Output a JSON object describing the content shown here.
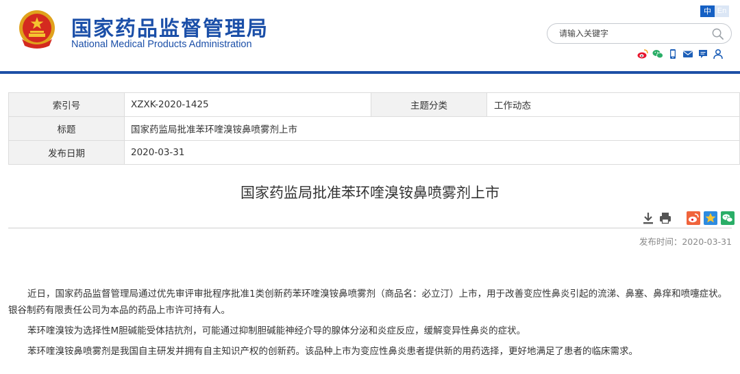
{
  "header": {
    "site_name_cn": "国家药品监督管理局",
    "site_name_en": "National Medical Products Administration",
    "lang_zh": "中",
    "lang_en": "En",
    "search_placeholder": "请输入关键字",
    "icons": [
      "weibo-icon",
      "wechat-icon",
      "mobile-icon",
      "mail-icon",
      "message-icon",
      "user-icon"
    ]
  },
  "info_table": {
    "index_label": "索引号",
    "index_value": "XZXK-2020-1425",
    "topic_label": "主题分类",
    "topic_value": "工作动态",
    "title_label": "标题",
    "title_value": "国家药监局批准苯环喹溴铵鼻喷雾剂上市",
    "date_label": "发布日期",
    "date_value": "2020-03-31"
  },
  "article": {
    "title": "国家药监局批准苯环喹溴铵鼻喷雾剂上市",
    "pub_time": "发布时间：2020-03-31",
    "paragraphs": [
      "近日，国家药品监督管理局通过优先审评审批程序批准1类创新药苯环喹溴铵鼻喷雾剂（商品名：必立汀）上市，用于改善变应性鼻炎引起的流涕、鼻塞、鼻痒和喷嚏症状。银谷制药有限责任公司为本品的药品上市许可持有人。",
      "苯环喹溴铵为选择性M胆碱能受体拮抗剂，可能通过抑制胆碱能神经介导的腺体分泌和炎症反应，缓解变异性鼻炎的症状。",
      "苯环喹溴铵鼻喷雾剂是我国自主研发并拥有自主知识产权的创新药。该品种上市为变应性鼻炎患者提供新的用药选择，更好地满足了患者的临床需求。"
    ]
  },
  "colors": {
    "brand_blue": "#1b4fa8",
    "rule_blue": "#1d4fa6",
    "lang_active": "#1560c4",
    "weibo_red": "#e6162d",
    "wechat_green": "#2aae67"
  }
}
